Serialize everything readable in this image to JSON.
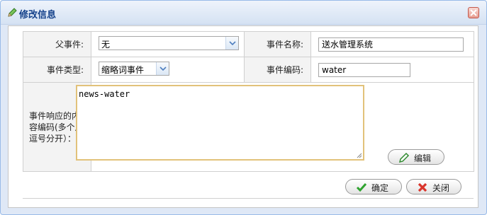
{
  "dialog": {
    "title": "修改信息"
  },
  "form": {
    "parent_event_label": "父事件:",
    "parent_event_value": "无",
    "event_name_label": "事件名称:",
    "event_name_value": "送水管理系统",
    "event_type_label": "事件类型:",
    "event_type_value": "缩略词事件",
    "event_code_label": "事件编码:",
    "event_code_value": "water",
    "response_code_label": "事件响应的内容编码(多个用逗号分开）：",
    "response_code_value": "news-water",
    "edit_button": "编辑"
  },
  "footer": {
    "confirm_button": "确定",
    "close_button": "关闭"
  },
  "colors": {
    "title_text": "#15428b",
    "textarea_border": "#e2c27a",
    "confirm_icon": "#2fa32f",
    "close_icon": "#d9342b"
  }
}
